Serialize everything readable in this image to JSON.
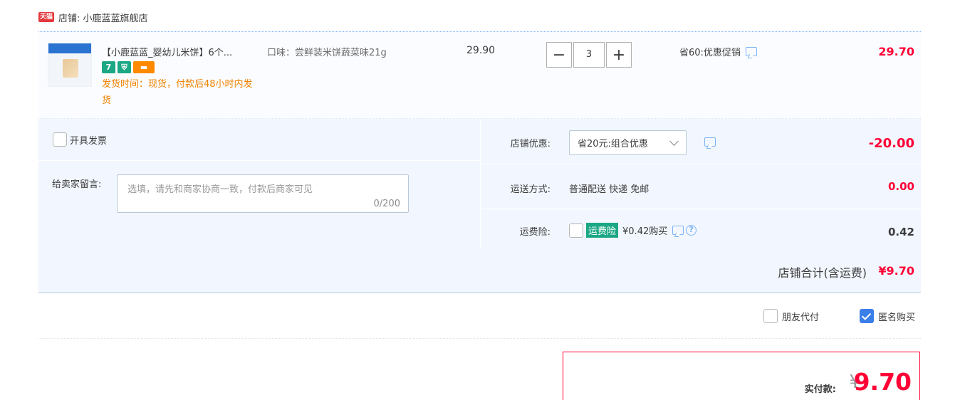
{
  "shop": {
    "badge": "天猫",
    "label": "店铺: 小鹿蓝蓝旗舰店"
  },
  "item": {
    "title": "【小鹿蓝蓝_婴幼儿米饼】6个...",
    "badges": [
      "7",
      "⛨",
      "▬"
    ],
    "ship_time": "发货时间：现货，付款后48小时内发货",
    "sku": "口味：尝鲜装米饼蔬菜味21g",
    "unit_price": "29.90",
    "quantity": "3",
    "qty_minus": "−",
    "qty_plus": "+",
    "promo": "省60:优惠促销",
    "total": "29.70"
  },
  "invoice": {
    "label": "开具发票"
  },
  "message": {
    "label": "给卖家留言:",
    "placeholder": "选填，请先和商家协商一致，付款后商家可见",
    "counter": "0/200"
  },
  "discount": {
    "label": "店铺优惠:",
    "selected": "省20元:组合优惠",
    "amount": "-20.00"
  },
  "shipping": {
    "label": "运送方式:",
    "value": "普通配送 快递 免邮",
    "amount": "0.00"
  },
  "insurance": {
    "label": "运费险:",
    "tag": "运费险",
    "price_text": "¥0.42购买",
    "help": "?",
    "amount": "0.42"
  },
  "shop_total": {
    "label": "店铺合计(含运费)",
    "value": "¥9.70"
  },
  "options": {
    "friend_pay": "朋友代付",
    "anonymous": "匿名购买"
  },
  "payment": {
    "label": "实付款:",
    "currency": "¥",
    "amount": "9.70"
  },
  "colors": {
    "accent_red": "#ff0036",
    "panel_blue": "#f2f7ff",
    "ship_orange": "#f08200",
    "tag_green": "#1ba784",
    "check_blue": "#3a7ee8"
  }
}
